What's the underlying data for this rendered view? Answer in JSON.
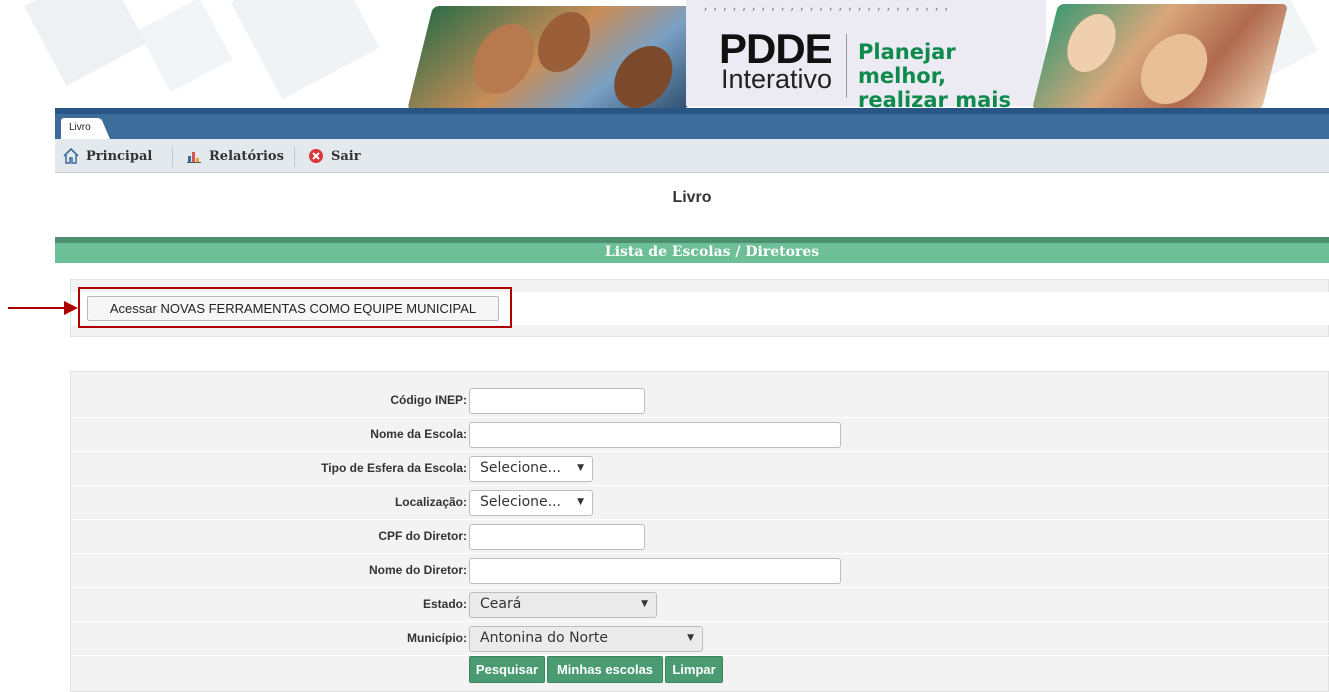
{
  "banner": {
    "logo_title": "PDDE",
    "logo_subtitle": "Interativo",
    "slogan_line1": "Planejar melhor,",
    "slogan_line2": "realizar mais"
  },
  "tabs": [
    {
      "label": "Livro"
    }
  ],
  "menu": {
    "items": [
      {
        "label": "Principal",
        "icon": "home-icon"
      },
      {
        "label": "Relatórios",
        "icon": "chart-icon"
      },
      {
        "label": "Sair",
        "icon": "exit-icon"
      }
    ]
  },
  "page": {
    "title": "Livro"
  },
  "section": {
    "title": "Lista de Escolas / Diretores"
  },
  "novas_ferramentas": {
    "button_label": "Acessar NOVAS FERRAMENTAS COMO EQUIPE MUNICIPAL"
  },
  "form": {
    "fields": [
      {
        "label": "Código INEP:",
        "value": ""
      },
      {
        "label": "Nome da Escola:",
        "value": ""
      },
      {
        "label": "Tipo de Esfera da Escola:",
        "value": "Selecione..."
      },
      {
        "label": "Localização:",
        "value": "Selecione..."
      },
      {
        "label": "CPF do Diretor:",
        "value": ""
      },
      {
        "label": "Nome do Diretor:",
        "value": ""
      },
      {
        "label": "Estado:",
        "value": "Ceará"
      },
      {
        "label": "Município:",
        "value": "Antonina do Norte"
      }
    ],
    "buttons": {
      "search": "Pesquisar",
      "my_schools": "Minhas escolas",
      "clear": "Limpar"
    }
  },
  "colors": {
    "nav_blue": "#3b6c9a",
    "section_green": "#6cbf96",
    "button_green": "#4a9b72",
    "highlight_red": "#b00000",
    "slogan_green": "#0e8a4d"
  }
}
